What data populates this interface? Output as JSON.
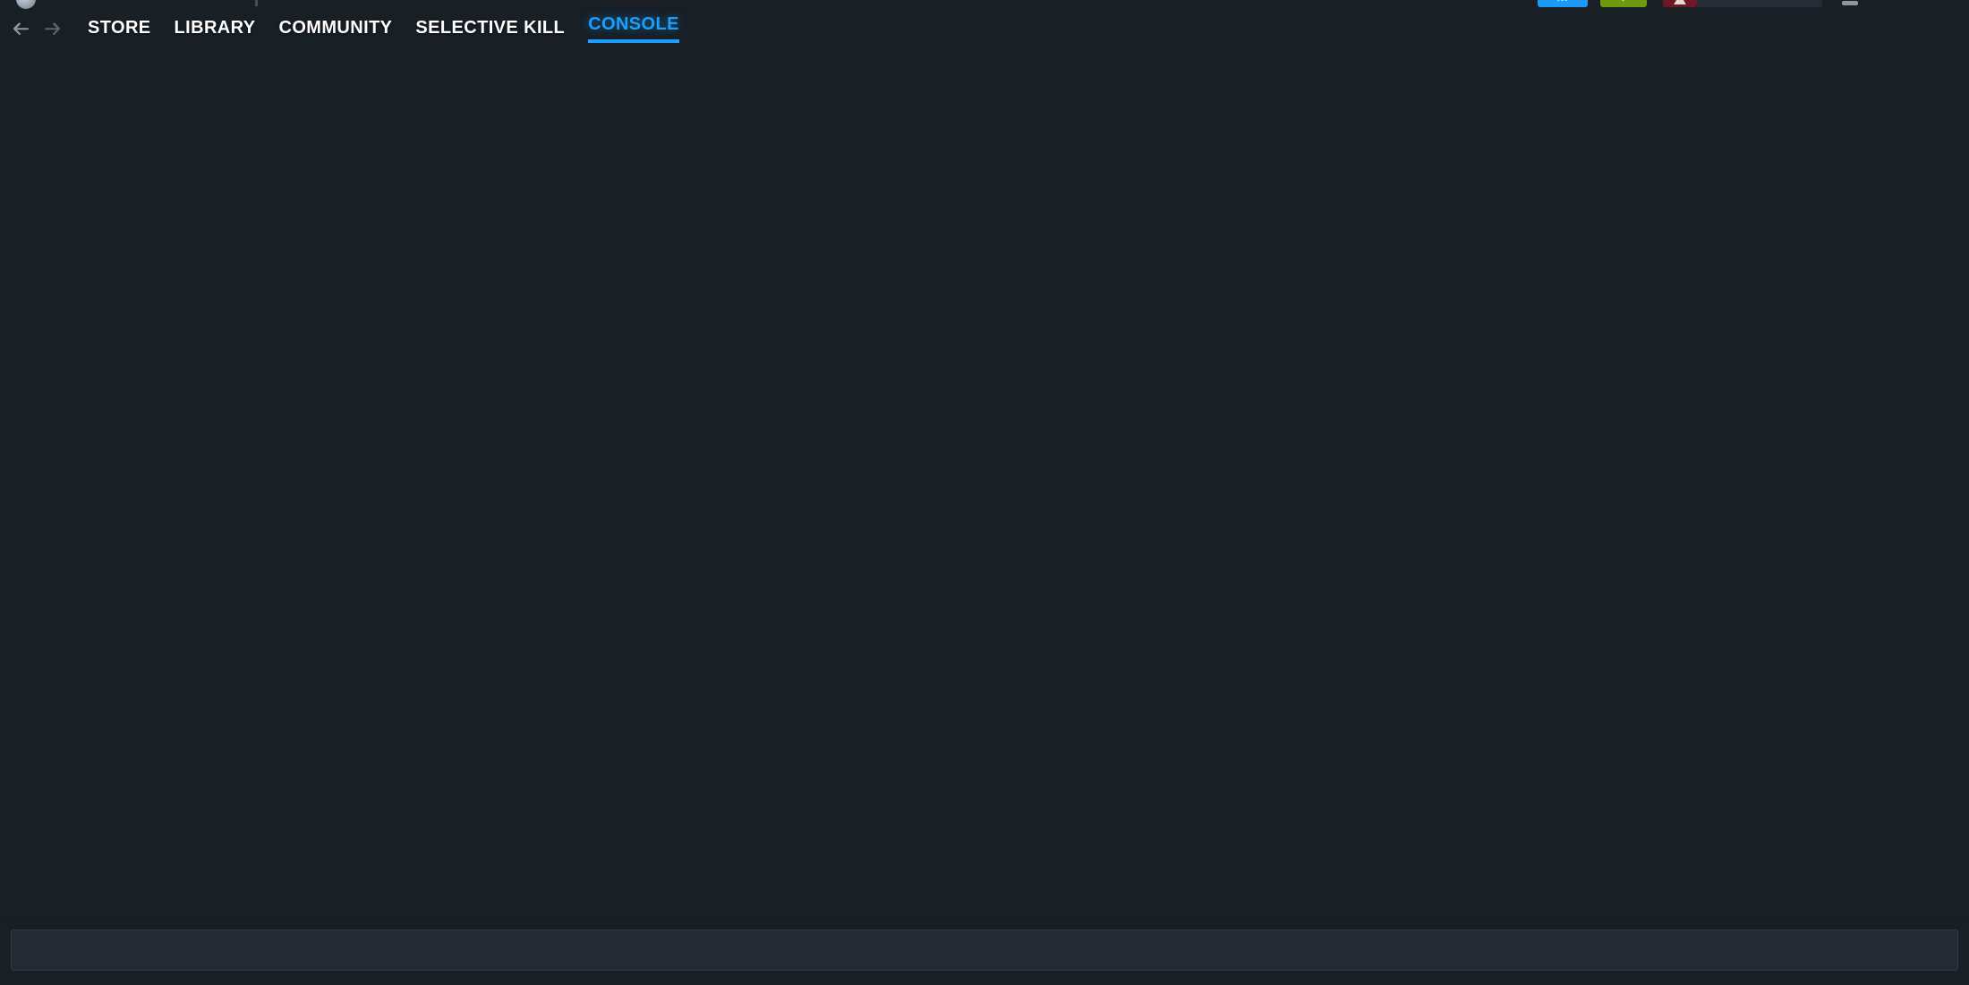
{
  "window": {
    "background_color": "#181f25",
    "logo_icon": "steam-logo-icon",
    "minimize_label": "",
    "tiles": [
      {
        "name": "tile-blue",
        "color": "#1b9af7",
        "glyph": "•••"
      },
      {
        "name": "tile-green",
        "color": "#6d9a0f",
        "glyph": "•"
      },
      {
        "name": "tile-red",
        "color": "#6d1824",
        "glyph": ""
      }
    ]
  },
  "nav": {
    "back_icon": "arrow-left-icon",
    "forward_icon": "arrow-right-icon",
    "accent_color": "#1a9fff",
    "tabs": [
      {
        "label": "STORE",
        "active": false
      },
      {
        "label": "LIBRARY",
        "active": false
      },
      {
        "label": "COMMUNITY",
        "active": false
      },
      {
        "label": "SELECTIVE KILL",
        "active": false
      },
      {
        "label": "CONSOLE",
        "active": true
      }
    ]
  },
  "console": {
    "output": "",
    "input_value": "",
    "input_placeholder": ""
  }
}
